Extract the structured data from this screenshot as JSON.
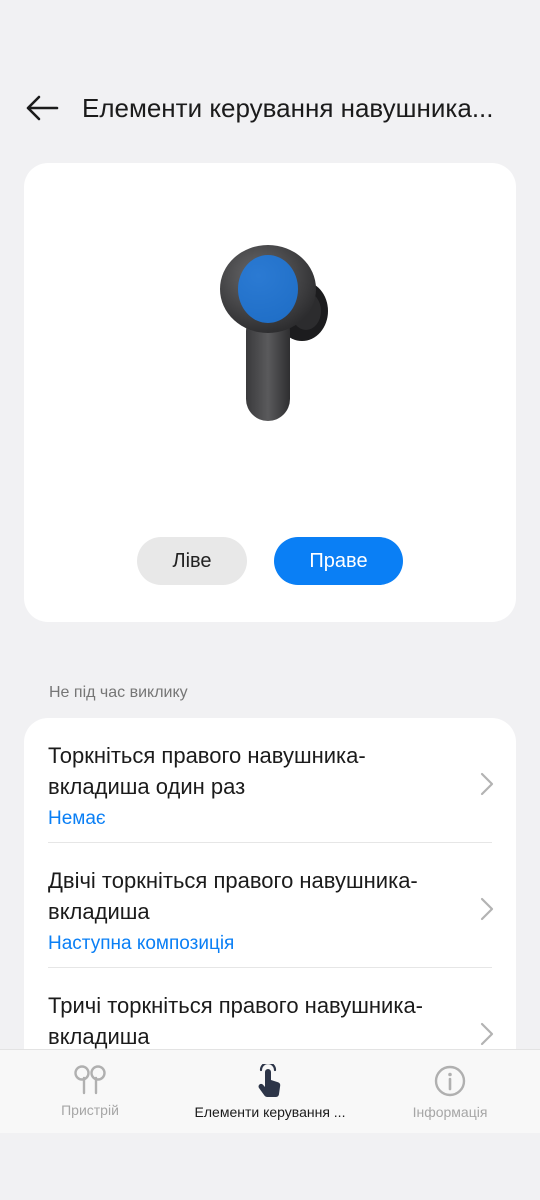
{
  "header": {
    "title": "Елементи керування навушника..."
  },
  "preview": {
    "left_label": "Ліве",
    "right_label": "Праве",
    "selected": "right"
  },
  "section": {
    "label": "Не під час виклику"
  },
  "items": [
    {
      "title": "Торкніться правого навушника-вкладиша один раз",
      "value": "Немає"
    },
    {
      "title": "Двічі торкніться правого навушника-вкладиша",
      "value": "Наступна композиція"
    },
    {
      "title": "Тричі торкніться правого навушника-вкладиша",
      "value": ""
    }
  ],
  "nav": {
    "tabs": [
      {
        "label": "Пристрій",
        "icon": "earbuds-icon",
        "active": false
      },
      {
        "label": "Елементи керування ...",
        "icon": "tap-hand-icon",
        "active": true
      },
      {
        "label": "Інформація",
        "icon": "info-icon",
        "active": false
      }
    ]
  },
  "colors": {
    "accent": "#0a7ff5",
    "background": "#f1f1f3"
  }
}
